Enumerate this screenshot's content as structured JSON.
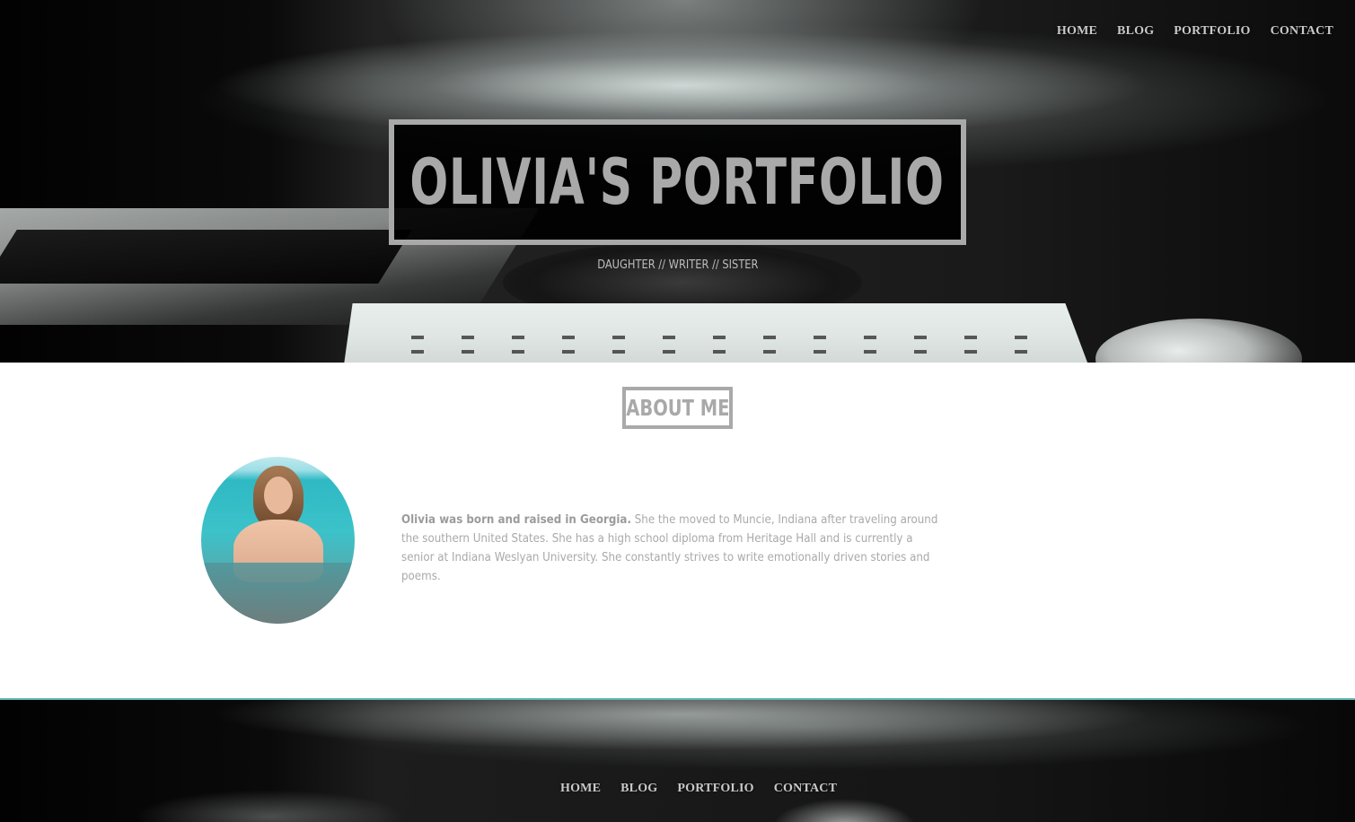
{
  "nav": {
    "items": [
      {
        "label": "HOME"
      },
      {
        "label": "BLOG"
      },
      {
        "label": "PORTFOLIO"
      },
      {
        "label": "CONTACT"
      }
    ]
  },
  "hero": {
    "title": "OLIVIA'S PORTFOLIO",
    "tagline": "DAUGHTER // WRITER // SISTER"
  },
  "about": {
    "heading": "ABOUT ME",
    "intro_bold": "Olivia was born and raised in Georgia.",
    "body": " She the moved to Muncie, Indiana after traveling around the southern United States. She has a high school diploma from Heritage Hall and is currently a senior at Indiana Weslyan University. She constantly strives to write emotionally driven stories and poems."
  },
  "footer_nav": {
    "items": [
      {
        "label": "HOME"
      },
      {
        "label": "BLOG"
      },
      {
        "label": "PORTFOLIO"
      },
      {
        "label": "CONTACT"
      }
    ]
  },
  "colors": {
    "accent_gray": "#a9a9a9",
    "footer_border": "#5fb7b0"
  }
}
